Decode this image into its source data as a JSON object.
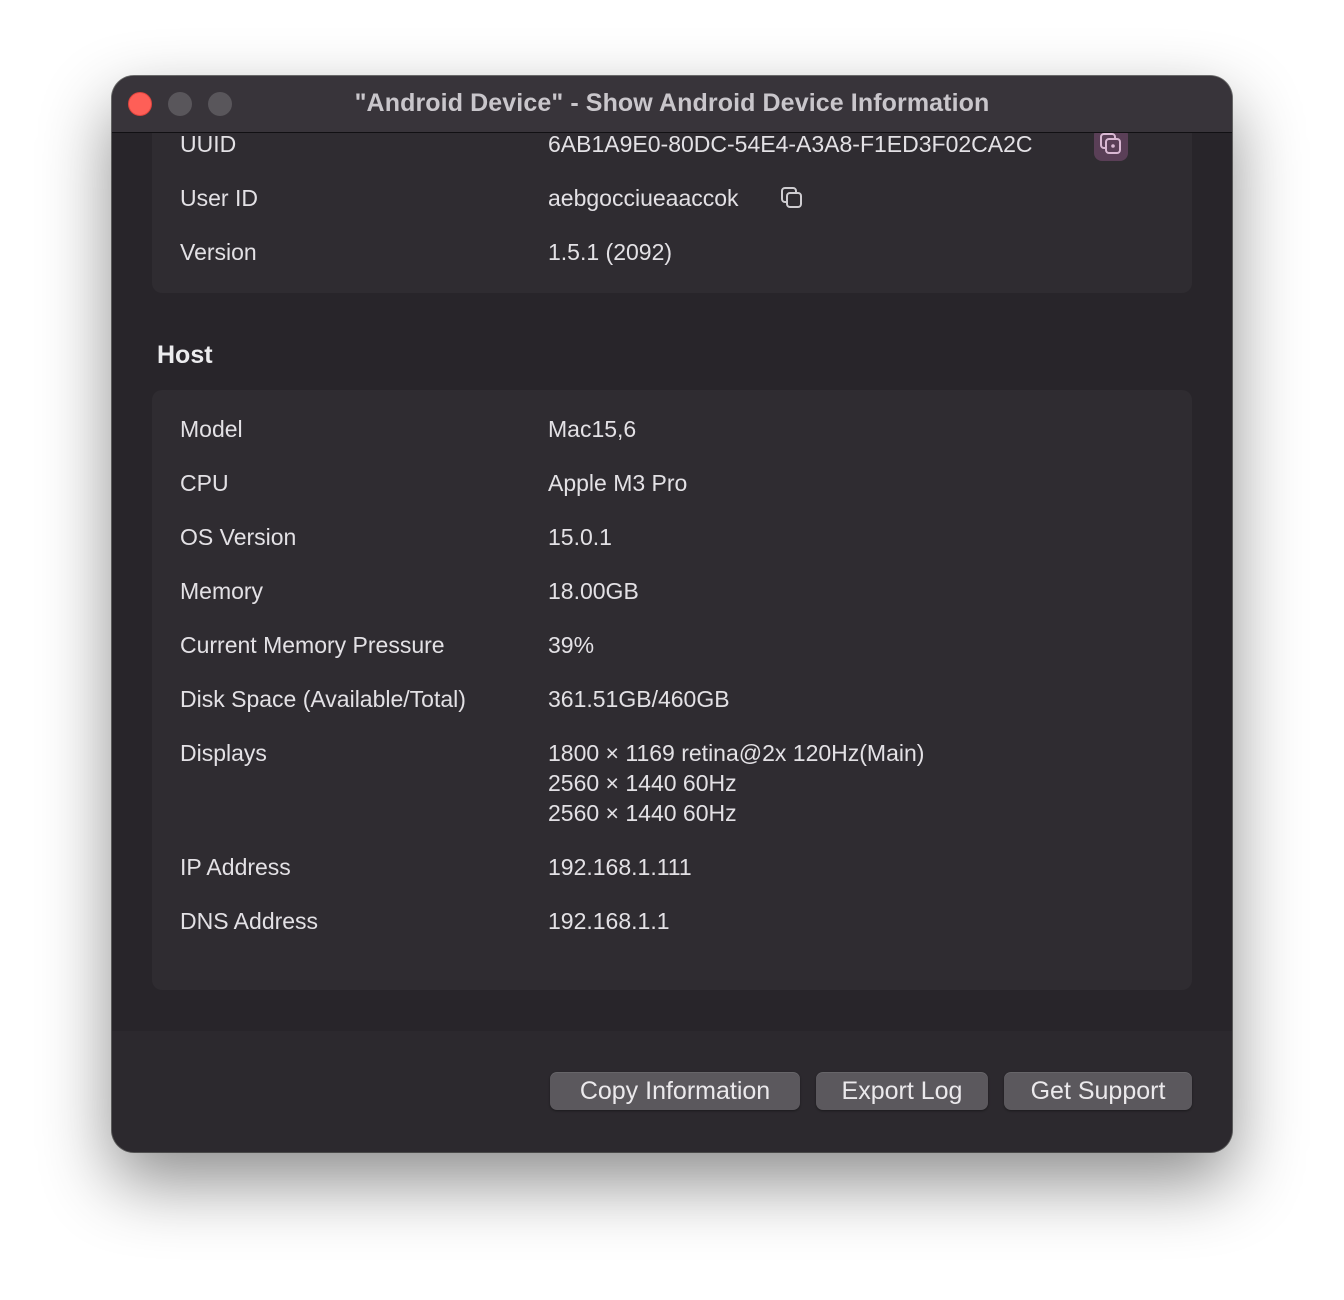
{
  "window": {
    "title": "\"Android Device\" - Show Android Device Information"
  },
  "device": {
    "rows": [
      {
        "label": "UUID",
        "value": "6AB1A9E0-80DC-54E4-A3A8-F1ED3F02CA2C"
      },
      {
        "label": "User ID",
        "value": "aebgocciueaaccok"
      },
      {
        "label": "Version",
        "value": "1.5.1 (2092)"
      }
    ]
  },
  "host": {
    "title": "Host",
    "rows": [
      {
        "label": "Model",
        "value": "Mac15,6"
      },
      {
        "label": "CPU",
        "value": "Apple M3 Pro"
      },
      {
        "label": "OS Version",
        "value": "15.0.1"
      },
      {
        "label": "Memory",
        "value": "18.00GB"
      },
      {
        "label": "Current Memory Pressure",
        "value": "39%"
      },
      {
        "label": "Disk Space (Available/Total)",
        "value": "361.51GB/460GB"
      },
      {
        "label": "Displays",
        "value_lines": [
          "1800 × 1169 retina@2x 120Hz(Main)",
          "2560 × 1440 60Hz",
          "2560 × 1440 60Hz"
        ]
      },
      {
        "label": "IP Address",
        "value": "192.168.1.111"
      },
      {
        "label": "DNS Address",
        "value": "192.168.1.1"
      }
    ]
  },
  "buttons": {
    "copy_information": "Copy Information",
    "export_log": "Export Log",
    "get_support": "Get Support"
  },
  "icons": {
    "copy": "copy-icon"
  },
  "colors": {
    "close": "#fe5f57",
    "copy_active_bg": "#5a3f57"
  }
}
